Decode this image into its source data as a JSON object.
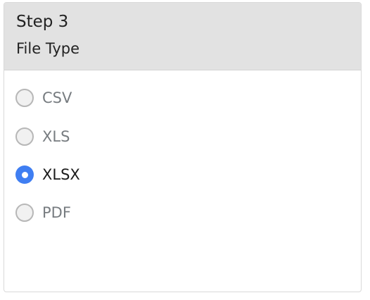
{
  "header": {
    "step_label": "Step 3",
    "section_title": "File Type"
  },
  "file_type": {
    "selected": "XLSX",
    "options": [
      {
        "label": "CSV",
        "checked": false
      },
      {
        "label": "XLS",
        "checked": false
      },
      {
        "label": "XLSX",
        "checked": true
      },
      {
        "label": "PDF",
        "checked": false
      }
    ]
  },
  "colors": {
    "accent": "#3f7ef2",
    "header_background": "#e2e2e2",
    "unselected_text": "#777c80",
    "selected_text": "#1b1b1b"
  }
}
